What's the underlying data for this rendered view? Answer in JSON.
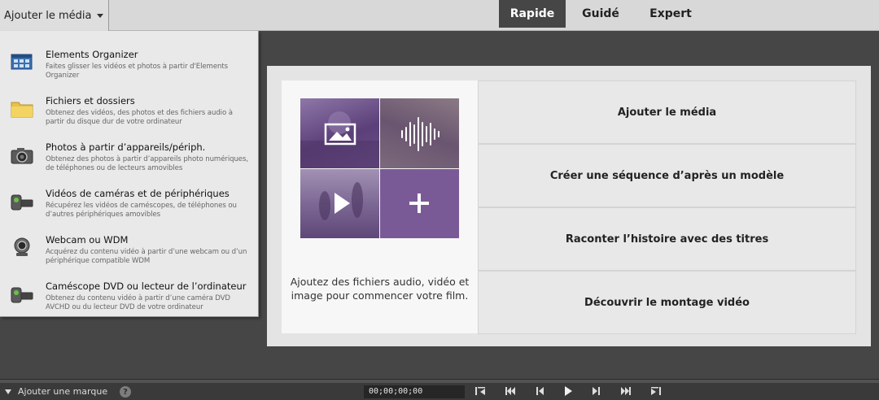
{
  "header": {
    "add_media_label": "Ajouter le média",
    "tabs": [
      {
        "label": "Rapide",
        "active": true
      },
      {
        "label": "Guidé",
        "active": false
      },
      {
        "label": "Expert",
        "active": false
      }
    ]
  },
  "menu": {
    "items": [
      {
        "title": "Elements Organizer",
        "desc": "Faites glisser les vidéos et photos à partir d'Elements Organizer",
        "icon": "organizer-icon"
      },
      {
        "title": "Fichiers et dossiers",
        "desc": "Obtenez des vidéos, des photos et des fichiers audio à partir du disque dur de votre ordinateur",
        "icon": "folder-icon"
      },
      {
        "title": "Photos à partir d’appareils/périph.",
        "desc": "Obtenez des photos à partir d’appareils photo numériques, de téléphones ou de lecteurs amovibles",
        "icon": "camera-icon"
      },
      {
        "title": "Vidéos de caméras et de périphériques",
        "desc": "Récupérez les vidéos de caméscopes, de téléphones ou d’autres périphériques amovibles",
        "icon": "camcorder-icon"
      },
      {
        "title": "Webcam ou WDM",
        "desc": "Acquérez du contenu vidéo à partir d’une webcam ou d’un périphérique compatible WDM",
        "icon": "webcam-icon"
      },
      {
        "title": "Caméscope DVD ou lecteur de l’ordinateur",
        "desc": "Obtenez du contenu vidéo à partir d’une caméra DVD AVCHD ou du lecteur DVD de votre ordinateur",
        "icon": "dvd-camcorder-icon"
      }
    ]
  },
  "main": {
    "card_text": "Ajoutez des fichiers audio, vidéo et image pour commencer votre film.",
    "options": [
      {
        "label": "Ajouter le média"
      },
      {
        "label": "Créer une séquence d’après un modèle"
      },
      {
        "label": "Raconter l’histoire avec des titres"
      },
      {
        "label": "Découvrir le montage vidéo"
      }
    ]
  },
  "footer": {
    "marker_label": "Ajouter une marque",
    "help_symbol": "?",
    "timecode": "00;00;00;00"
  },
  "colors": {
    "accent_purple": "#7a5a96",
    "active_tab_bg": "#464646"
  }
}
